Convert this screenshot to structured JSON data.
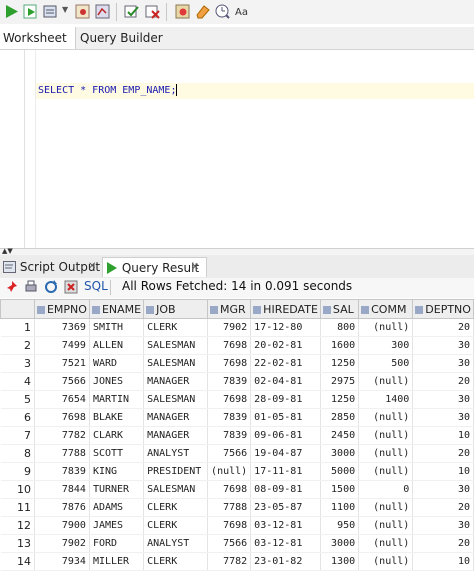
{
  "toolbar": {
    "icons": [
      "run-statement-icon",
      "run-script-icon",
      "autotrace-icon",
      "explain-plan-icon",
      "commit-icon",
      "rollback-icon",
      "sql-tuning-icon",
      "clear-icon",
      "sql-history-icon",
      "format-icon"
    ]
  },
  "editor_tabs": [
    "Worksheet",
    "Query Builder"
  ],
  "editor": {
    "code": "SELECT * FROM EMP_NAME;"
  },
  "result_tabs": {
    "script_output": "Script Output",
    "query_result": "Query Result"
  },
  "result_toolbar": {
    "sql_label": "SQL",
    "status": "All Rows Fetched: 14 in 0.091 seconds"
  },
  "grid": {
    "columns": [
      "EMPNO",
      "ENAME",
      "JOB",
      "MGR",
      "HIREDATE",
      "SAL",
      "COMM",
      "DEPTNO"
    ],
    "rows": [
      [
        "1",
        "7369",
        "SMITH",
        "CLERK",
        "7902",
        "17-12-80",
        "800",
        "(null)",
        "20"
      ],
      [
        "2",
        "7499",
        "ALLEN",
        "SALESMAN",
        "7698",
        "20-02-81",
        "1600",
        "300",
        "30"
      ],
      [
        "3",
        "7521",
        "WARD",
        "SALESMAN",
        "7698",
        "22-02-81",
        "1250",
        "500",
        "30"
      ],
      [
        "4",
        "7566",
        "JONES",
        "MANAGER",
        "7839",
        "02-04-81",
        "2975",
        "(null)",
        "20"
      ],
      [
        "5",
        "7654",
        "MARTIN",
        "SALESMAN",
        "7698",
        "28-09-81",
        "1250",
        "1400",
        "30"
      ],
      [
        "6",
        "7698",
        "BLAKE",
        "MANAGER",
        "7839",
        "01-05-81",
        "2850",
        "(null)",
        "30"
      ],
      [
        "7",
        "7782",
        "CLARK",
        "MANAGER",
        "7839",
        "09-06-81",
        "2450",
        "(null)",
        "10"
      ],
      [
        "8",
        "7788",
        "SCOTT",
        "ANALYST",
        "7566",
        "19-04-87",
        "3000",
        "(null)",
        "20"
      ],
      [
        "9",
        "7839",
        "KING",
        "PRESIDENT",
        "(null)",
        "17-11-81",
        "5000",
        "(null)",
        "10"
      ],
      [
        "10",
        "7844",
        "TURNER",
        "SALESMAN",
        "7698",
        "08-09-81",
        "1500",
        "0",
        "30"
      ],
      [
        "11",
        "7876",
        "ADAMS",
        "CLERK",
        "7788",
        "23-05-87",
        "1100",
        "(null)",
        "20"
      ],
      [
        "12",
        "7900",
        "JAMES",
        "CLERK",
        "7698",
        "03-12-81",
        "950",
        "(null)",
        "30"
      ],
      [
        "13",
        "7902",
        "FORD",
        "ANALYST",
        "7566",
        "03-12-81",
        "3000",
        "(null)",
        "20"
      ],
      [
        "14",
        "7934",
        "MILLER",
        "CLERK",
        "7782",
        "23-01-82",
        "1300",
        "(null)",
        "10"
      ]
    ]
  }
}
